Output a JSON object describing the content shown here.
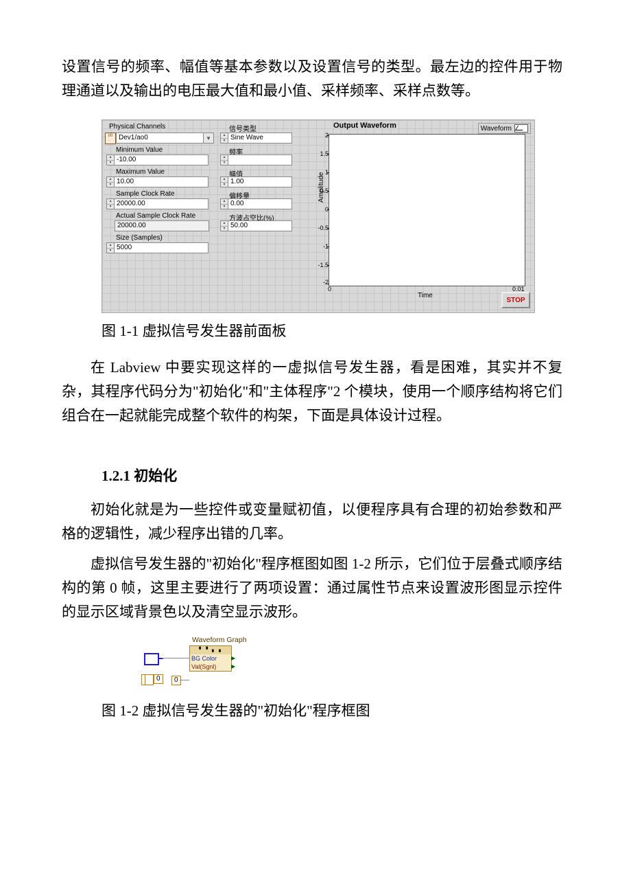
{
  "para1": "设置信号的频率、幅值等基本参数以及设置信号的类型。最左边的控件用于物理通道以及输出的电压最大值和最小值、采样频率、采样点数等。",
  "caption1": "图 1-1 虚拟信号发生器前面板",
  "para2": "在 Labview 中要实现这样的一虚拟信号发生器，看是困难，其实并不复杂，其程序代码分为\"初始化\"和\"主体程序\"2 个模块，使用一个顺序结构将它们组合在一起就能完成整个软件的构架，下面是具体设计过程。",
  "heading1": "1.2.1 初始化",
  "para3": "初始化就是为一些控件或变量赋初值，以便程序具有合理的初始参数和严格的逻辑性，减少程序出错的几率。",
  "para4": "虚拟信号发生器的\"初始化\"程序框图如图 1-2 所示，它们位于层叠式顺序结构的第 0 帧，这里主要进行了两项设置：通过属性节点来设置波形图显示控件的显示区域背景色以及清空显示波形。",
  "caption2": "图 1-2 虚拟信号发生器的\"初始化\"程序框图",
  "lv": {
    "physicalChannels_lbl": "Physical Channels",
    "physicalChannels_val": "Dev1/ao0",
    "minVal_lbl": "Minimum Value",
    "minVal_val": "-10.00",
    "maxVal_lbl": "Maximum Value",
    "maxVal_val": "10.00",
    "clockRate_lbl": "Sample Clock Rate",
    "clockRate_val": "20000.00",
    "actualClock_lbl": "Actual Sample Clock Rate",
    "actualClock_val": "20000.00",
    "size_lbl": "Size (Samples)",
    "size_val": "5000",
    "sigtype_lbl": "信号类型",
    "sigtype_val": "Sine Wave",
    "freq_lbl": "频率",
    "freq_val": "",
    "amp_lbl": "幅值",
    "amp_val": "1.00",
    "offset_lbl": "偏移量",
    "offset_val": "0.00",
    "duty_lbl": "方波占空比(%)",
    "duty_val": "50.00",
    "chart_title": "Output Waveform",
    "legend_name": "Waveform",
    "xlabel": "Time",
    "ylabel": "Amplitude",
    "stop": "STOP",
    "yticks": [
      "2",
      "1.5",
      "1",
      "0.5",
      "0",
      "-0.5",
      "-1",
      "-1.5",
      "-2"
    ],
    "xticks": [
      "0",
      "0.01"
    ]
  },
  "bd": {
    "title": "Waveform Graph",
    "prop1": "BG Color",
    "prop2": "Val(Sgnl)",
    "const0a": "0",
    "const0b": "0"
  },
  "chart_data": {
    "type": "line",
    "title": "Output Waveform",
    "xlabel": "Time",
    "ylabel": "Amplitude",
    "xlim": [
      0,
      0.01
    ],
    "ylim": [
      -2,
      2
    ],
    "yticks": [
      2,
      1.5,
      1,
      0.5,
      0,
      -0.5,
      -1,
      -1.5,
      -2
    ],
    "xticks": [
      0,
      0.01
    ],
    "series": [
      {
        "name": "Waveform",
        "x": [],
        "y": []
      }
    ]
  }
}
